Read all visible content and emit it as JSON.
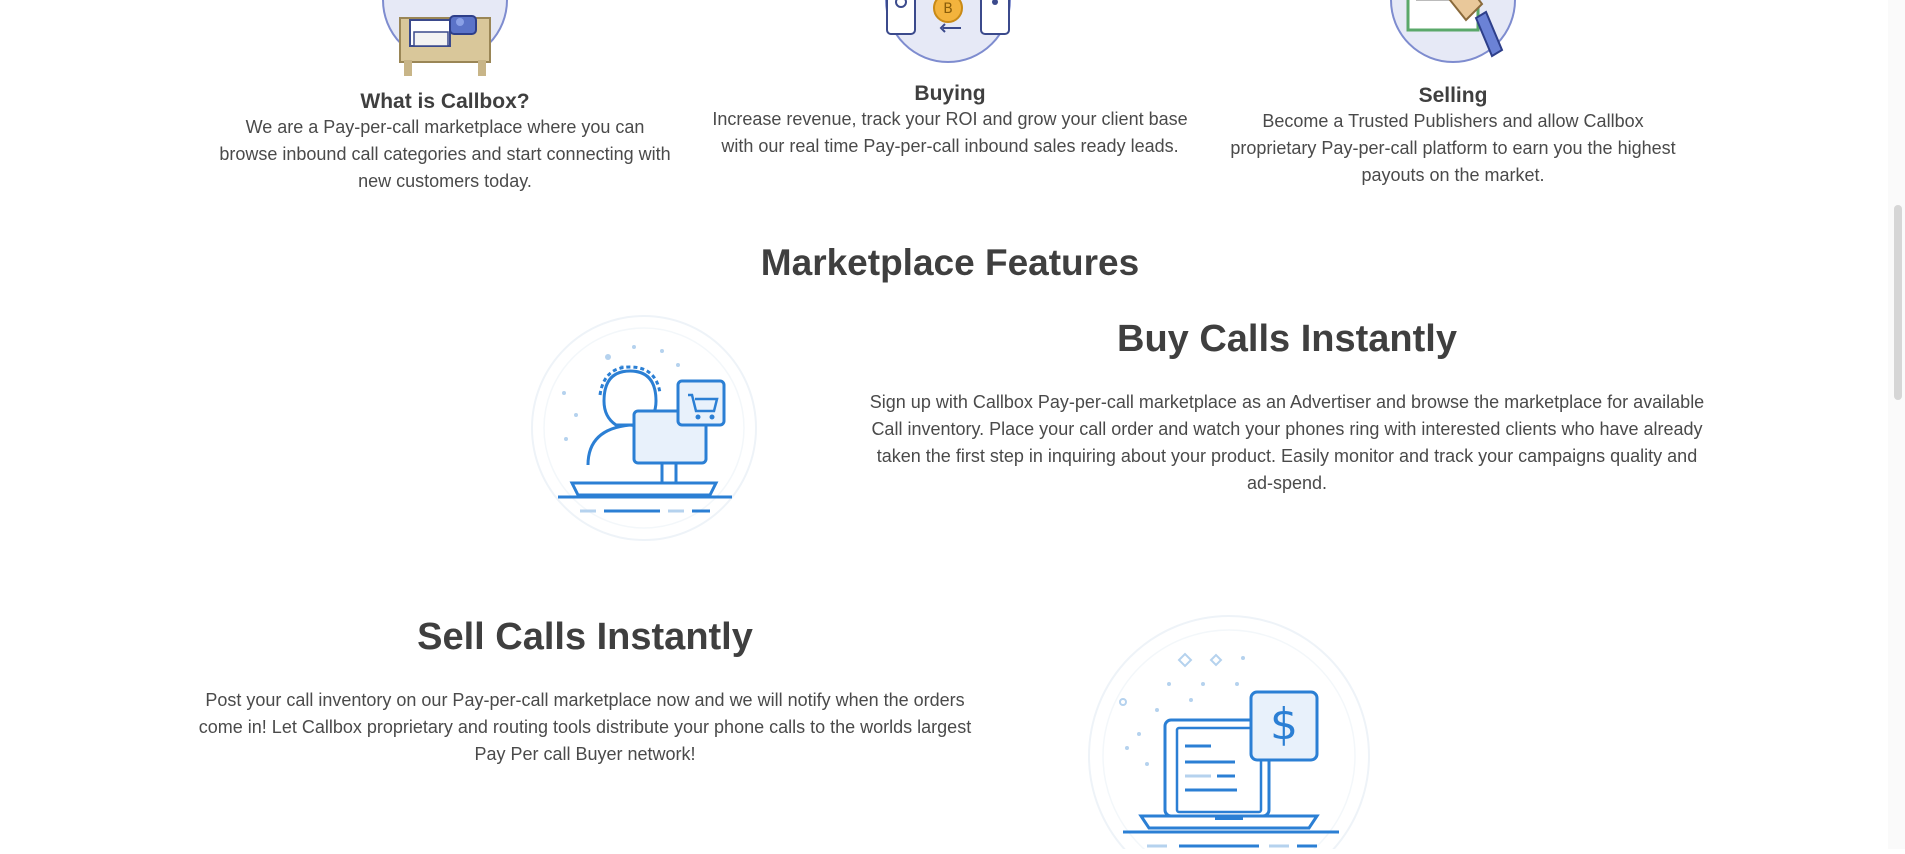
{
  "intro": {
    "columns": [
      {
        "title": "What is Callbox?",
        "text": "We are a Pay-per-call marketplace where you can browse inbound call categories and start connecting with new customers today.",
        "icon": "desk-computer-icon"
      },
      {
        "title": "Buying",
        "text": "Increase revenue, track your ROI and grow your client base with our real time Pay-per-call inbound sales ready leads.",
        "icon": "coin-phones-icon"
      },
      {
        "title": "Selling",
        "text": "Become a Trusted Publishers and allow Callbox proprietary Pay-per-call platform to earn you the highest payouts on the market.",
        "icon": "handshake-book-icon"
      }
    ]
  },
  "marketplace": {
    "title": "Marketplace Features",
    "buy": {
      "title": "Buy Calls Instantly",
      "text": "Sign up with Callbox Pay-per-call marketplace as an Advertiser and browse the marketplace for available Call inventory. Place your call order and watch your phones ring with interested clients who have already taken the first step in inquiring about your product. Easily monitor and track your campaigns quality and ad-spend.",
      "icon": "buyer-computer-cart-icon"
    },
    "sell": {
      "title": "Sell Calls Instantly",
      "text": "Post your call inventory on our Pay-per-call marketplace now and we will notify when the orders come in! Let Callbox proprietary and routing tools distribute your phone calls to the worlds largest Pay Per call Buyer network!",
      "icon": "laptop-dollar-icon"
    }
  },
  "colors": {
    "heading": "#3f3f3f",
    "text": "#4a4a4a",
    "icon_blue": "#2b7fd4",
    "icon_light": "#cfe3f5",
    "circle_fill": "#e6e9f6",
    "circle_stroke": "#7e8ccf"
  }
}
